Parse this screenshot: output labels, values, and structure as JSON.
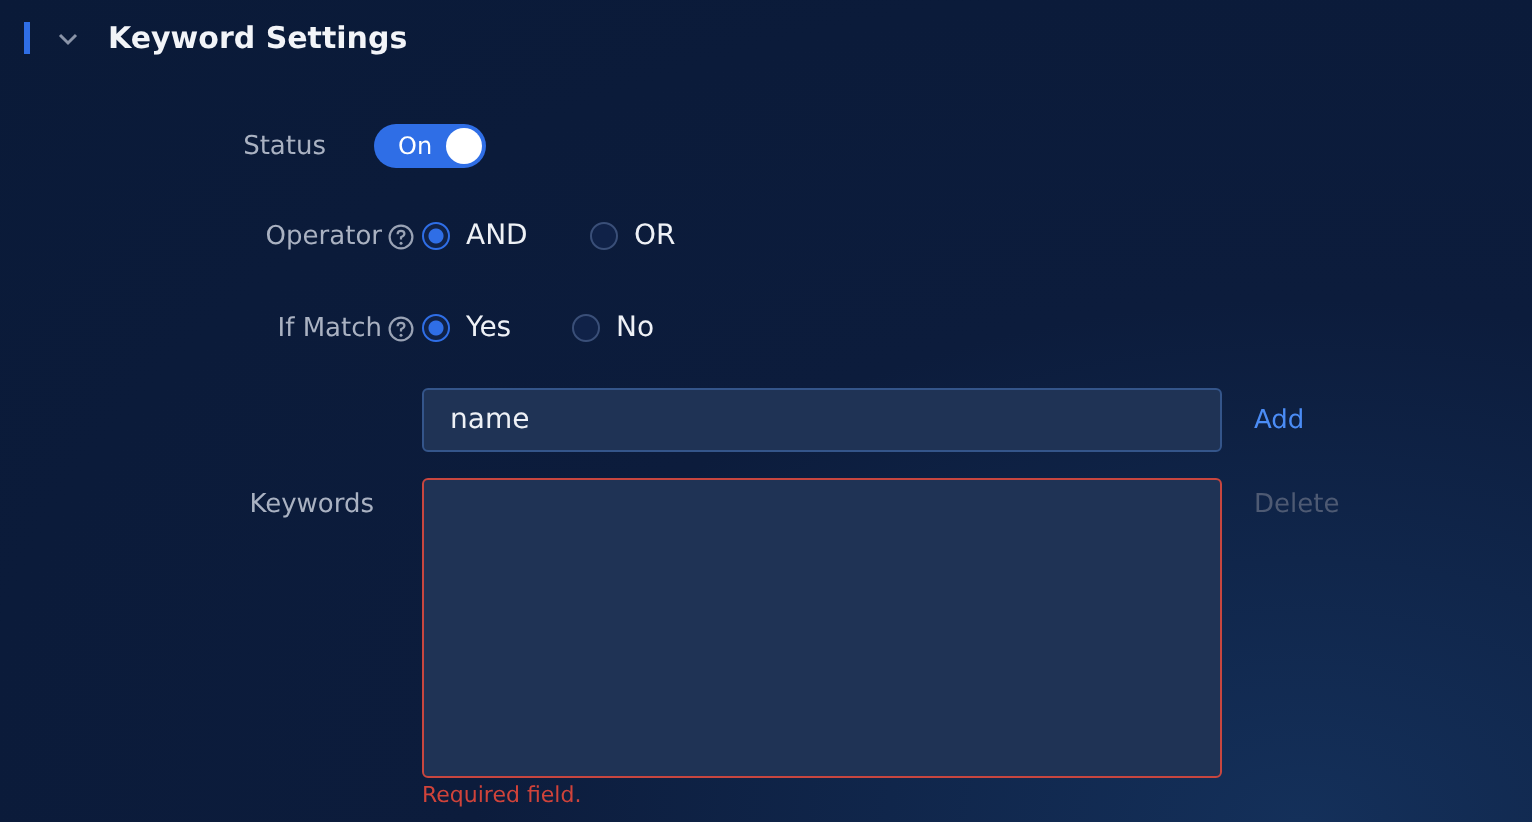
{
  "section": {
    "title": "Keyword Settings",
    "expanded": true
  },
  "status": {
    "label": "Status",
    "on": true,
    "text": "On"
  },
  "operator": {
    "label": "Operator",
    "options": [
      {
        "label": "AND",
        "selected": true
      },
      {
        "label": "OR",
        "selected": false
      }
    ]
  },
  "if_match": {
    "label": "If Match",
    "options": [
      {
        "label": "Yes",
        "selected": true
      },
      {
        "label": "No",
        "selected": false
      }
    ]
  },
  "keyword_input": {
    "value": "name",
    "action": "Add"
  },
  "keywords": {
    "label": "Keywords",
    "action": "Delete",
    "action_disabled": true,
    "error": "Required field."
  }
}
